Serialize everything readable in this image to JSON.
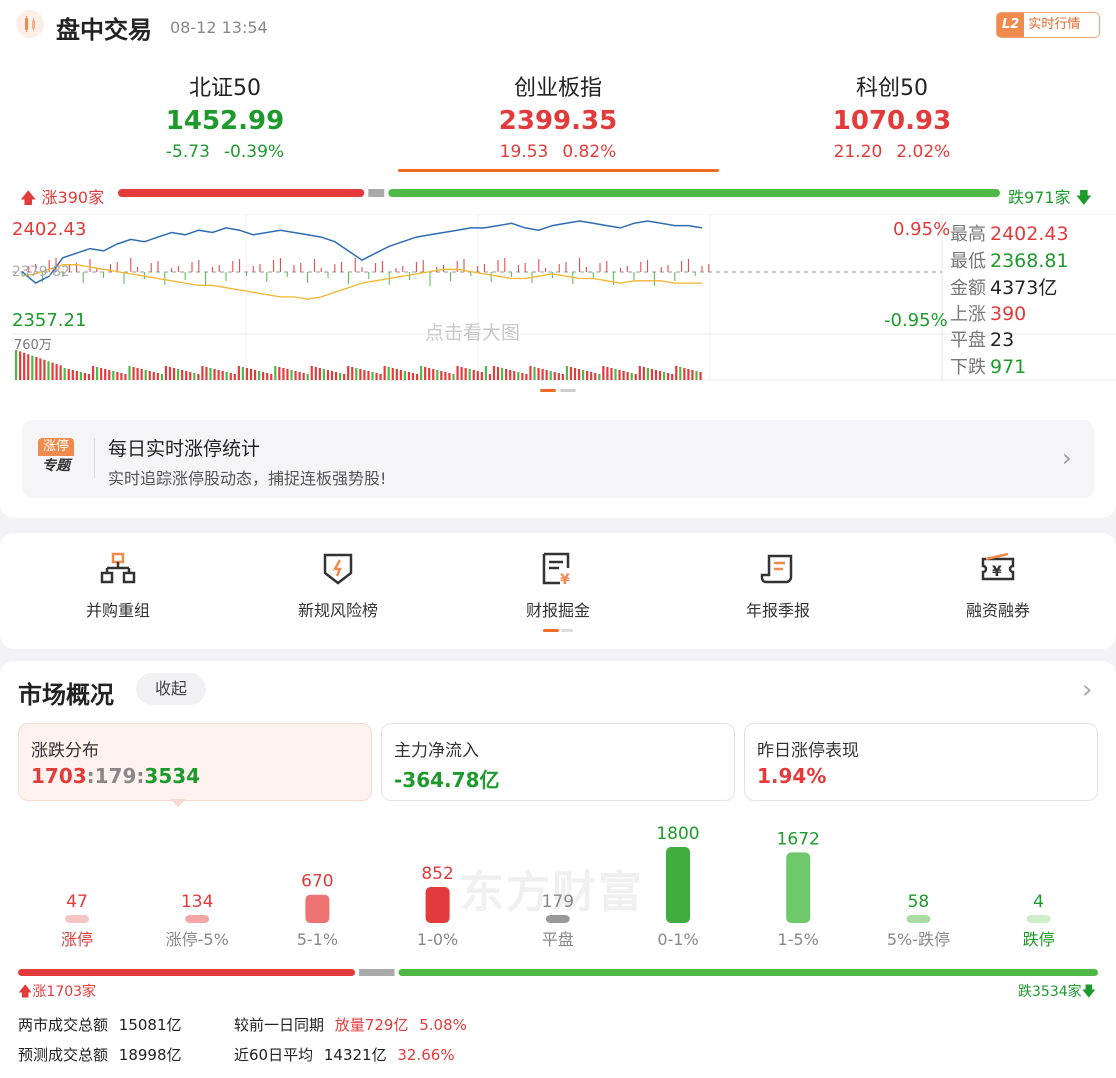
{
  "header": {
    "title": "盘中交易",
    "time": "08-12 13:54",
    "l2_badge": "L2",
    "l2_label": "实时行情"
  },
  "indices": [
    {
      "name": "北证50",
      "price": "1452.99",
      "change": "-5.73",
      "pct": "-0.39%",
      "color": "green"
    },
    {
      "name": "创业板指",
      "price": "2399.35",
      "change": "19.53",
      "pct": "0.82%",
      "color": "red"
    },
    {
      "name": "科创50",
      "price": "1070.93",
      "change": "21.20",
      "pct": "2.02%",
      "color": "red"
    }
  ],
  "breadth_bar": {
    "up_label": "涨390家",
    "down_label": "跌971家",
    "up": 390,
    "flat": 23,
    "down": 971
  },
  "mini_chart": {
    "high_label": "2402.43",
    "low_label": "2357.21",
    "mid_label_obscured": "2379.82",
    "pct_high": "0.95%",
    "pct_low": "-0.95%",
    "volume_label": "760万",
    "watermark": "点击看大图",
    "index_series": [
      2380,
      2375,
      2378,
      2386,
      2388,
      2390,
      2389,
      2392,
      2394,
      2393,
      2395,
      2397,
      2396,
      2398,
      2397,
      2399,
      2398,
      2396,
      2397,
      2398,
      2397,
      2396,
      2395,
      2393,
      2389,
      2385,
      2388,
      2391,
      2393,
      2395,
      2396,
      2397,
      2398,
      2399,
      2399,
      2400,
      2401,
      2399,
      2398,
      2400,
      2401,
      2402,
      2401,
      2400,
      2399,
      2401,
      2402,
      2401,
      2400,
      2400,
      2399
    ],
    "avg_series": [
      2378,
      2379,
      2381,
      2383,
      2383,
      2382,
      2381,
      2380,
      2379,
      2378,
      2377,
      2376,
      2375,
      2374,
      2374,
      2373,
      2372,
      2371,
      2370,
      2369,
      2369,
      2368,
      2369,
      2371,
      2373,
      2375,
      2376,
      2377,
      2378,
      2379,
      2380,
      2381,
      2381,
      2380,
      2379,
      2378,
      2377,
      2377,
      2378,
      2379,
      2378,
      2377,
      2377,
      2376,
      2375,
      2376,
      2376,
      2376,
      2375,
      2375,
      2375
    ],
    "ymin": 2357.21,
    "ymax": 2402.43,
    "base": 2379.82
  },
  "stats": [
    {
      "key": "最高",
      "value": "2402.43",
      "color": "red"
    },
    {
      "key": "最低",
      "value": "2368.81",
      "color": "green"
    },
    {
      "key": "金额",
      "value": "4373亿",
      "color": "black"
    },
    {
      "key": "上涨",
      "value": "390",
      "color": "red"
    },
    {
      "key": "平盘",
      "value": "23",
      "color": "black"
    },
    {
      "key": "下跌",
      "value": "971",
      "color": "green"
    }
  ],
  "promo": {
    "icon_top": "涨停",
    "icon_bottom": "专题",
    "title": "每日实时涨停统计",
    "subtitle": "实时追踪涨停股动态，捕捉连板强势股!"
  },
  "tools": [
    {
      "label": "并购重组",
      "icon": "merger-icon"
    },
    {
      "label": "新规风险榜",
      "icon": "shield-bolt-icon"
    },
    {
      "label": "财报掘金",
      "icon": "report-yen-icon"
    },
    {
      "label": "年报季报",
      "icon": "scroll-icon"
    },
    {
      "label": "融资融券",
      "icon": "ticket-yen-icon"
    }
  ],
  "market": {
    "title": "市场概况",
    "collapse_label": "收起",
    "boxes": [
      {
        "title": "涨跌分布",
        "up": "1703",
        "flat": "179",
        "down": "3534"
      },
      {
        "title": "主力净流入",
        "value": "-364.78亿"
      },
      {
        "title": "昨日涨停表现",
        "value": "1.94%"
      }
    ],
    "watermark": "东方财富",
    "distribution": [
      {
        "label": "涨停",
        "value": 47,
        "color": "#f7c4c4",
        "label_color": "#e33b3b"
      },
      {
        "label": "涨停-5%",
        "value": 134,
        "color": "#f4a5a5",
        "label_color": "#888"
      },
      {
        "label": "5-1%",
        "value": 670,
        "color": "#ee7474",
        "label_color": "#888"
      },
      {
        "label": "1-0%",
        "value": 852,
        "color": "#e33b3b",
        "label_color": "#888"
      },
      {
        "label": "平盘",
        "value": 179,
        "color": "#999999",
        "label_color": "#888"
      },
      {
        "label": "0-1%",
        "value": 1800,
        "color": "#3fae3f",
        "label_color": "#888"
      },
      {
        "label": "1-5%",
        "value": 1672,
        "color": "#6fc86b",
        "label_color": "#888"
      },
      {
        "label": "5%-跌停",
        "value": 58,
        "color": "#a8dca4",
        "label_color": "#888"
      },
      {
        "label": "跌停",
        "value": 4,
        "color": "#cdeec9",
        "label_color": "#1d9a2c"
      }
    ],
    "total_bar": {
      "up_label": "涨1703家",
      "down_label": "跌3534家",
      "up": 1703,
      "flat": 179,
      "down": 3534
    },
    "summary": [
      {
        "k1": "两市成交总额",
        "v1": "15081亿",
        "k2": "较前一日同期",
        "v2a": "放量729亿",
        "v2b": "5.08%"
      },
      {
        "k1": "预测成交总额",
        "v1": "18998亿",
        "k2": "近60日平均",
        "v2a": "14321亿",
        "v2b": "32.66%"
      }
    ]
  },
  "colors": {
    "up": "#e33b3b",
    "down": "#1d9a2c",
    "accent": "#f06b25"
  }
}
